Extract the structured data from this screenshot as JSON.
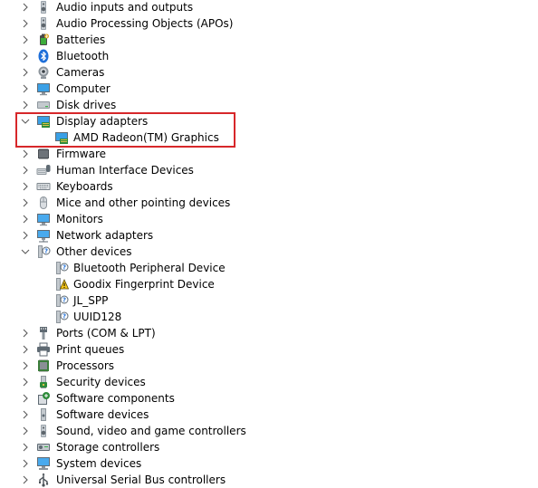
{
  "tree": {
    "rows": [
      {
        "label": "Audio inputs and outputs",
        "icon": "speaker-icon",
        "expander": "collapsed",
        "level": 0
      },
      {
        "label": "Audio Processing Objects (APOs)",
        "icon": "speaker-icon",
        "expander": "collapsed",
        "level": 0
      },
      {
        "label": "Batteries",
        "icon": "battery-icon",
        "expander": "collapsed",
        "level": 0
      },
      {
        "label": "Bluetooth",
        "icon": "bluetooth-icon",
        "expander": "collapsed",
        "level": 0
      },
      {
        "label": "Cameras",
        "icon": "camera-icon",
        "expander": "collapsed",
        "level": 0
      },
      {
        "label": "Computer",
        "icon": "computer-icon",
        "expander": "collapsed",
        "level": 0
      },
      {
        "label": "Disk drives",
        "icon": "disk-drive-icon",
        "expander": "collapsed",
        "level": 0
      },
      {
        "label": "Display adapters",
        "icon": "display-adapter-icon",
        "expander": "expanded",
        "level": 0
      },
      {
        "label": "AMD Radeon(TM) Graphics",
        "icon": "display-adapter-icon",
        "expander": "none",
        "level": 1
      },
      {
        "label": "Firmware",
        "icon": "firmware-icon",
        "expander": "collapsed",
        "level": 0
      },
      {
        "label": "Human Interface Devices",
        "icon": "hid-icon",
        "expander": "collapsed",
        "level": 0
      },
      {
        "label": "Keyboards",
        "icon": "keyboard-icon",
        "expander": "collapsed",
        "level": 0
      },
      {
        "label": "Mice and other pointing devices",
        "icon": "mouse-icon",
        "expander": "collapsed",
        "level": 0
      },
      {
        "label": "Monitors",
        "icon": "monitor-icon",
        "expander": "collapsed",
        "level": 0
      },
      {
        "label": "Network adapters",
        "icon": "network-adapter-icon",
        "expander": "collapsed",
        "level": 0
      },
      {
        "label": "Other devices",
        "icon": "unknown-device-icon",
        "expander": "expanded",
        "level": 0
      },
      {
        "label": "Bluetooth Peripheral Device",
        "icon": "unknown-device-icon",
        "expander": "none",
        "level": 1
      },
      {
        "label": "Goodix Fingerprint Device",
        "icon": "warning-device-icon",
        "expander": "none",
        "level": 1
      },
      {
        "label": "JL_SPP",
        "icon": "unknown-device-icon",
        "expander": "none",
        "level": 1
      },
      {
        "label": "UUID128",
        "icon": "unknown-device-icon",
        "expander": "none",
        "level": 1
      },
      {
        "label": "Ports (COM & LPT)",
        "icon": "port-icon",
        "expander": "collapsed",
        "level": 0
      },
      {
        "label": "Print queues",
        "icon": "printer-icon",
        "expander": "collapsed",
        "level": 0
      },
      {
        "label": "Processors",
        "icon": "processor-icon",
        "expander": "collapsed",
        "level": 0
      },
      {
        "label": "Security devices",
        "icon": "security-device-icon",
        "expander": "collapsed",
        "level": 0
      },
      {
        "label": "Software components",
        "icon": "software-component-icon",
        "expander": "collapsed",
        "level": 0
      },
      {
        "label": "Software devices",
        "icon": "software-device-icon",
        "expander": "collapsed",
        "level": 0
      },
      {
        "label": "Sound, video and game controllers",
        "icon": "speaker-icon",
        "expander": "collapsed",
        "level": 0
      },
      {
        "label": "Storage controllers",
        "icon": "storage-controller-icon",
        "expander": "collapsed",
        "level": 0
      },
      {
        "label": "System devices",
        "icon": "system-device-icon",
        "expander": "collapsed",
        "level": 0
      },
      {
        "label": "Universal Serial Bus controllers",
        "icon": "usb-icon",
        "expander": "collapsed",
        "level": 0
      }
    ]
  },
  "highlight": {
    "color": "#d7272a",
    "rows": [
      "Display adapters",
      "AMD Radeon(TM) Graphics"
    ]
  },
  "colors": {
    "chevron": "#5a5a5a",
    "text": "#000000",
    "highlight": "#d7272a"
  }
}
